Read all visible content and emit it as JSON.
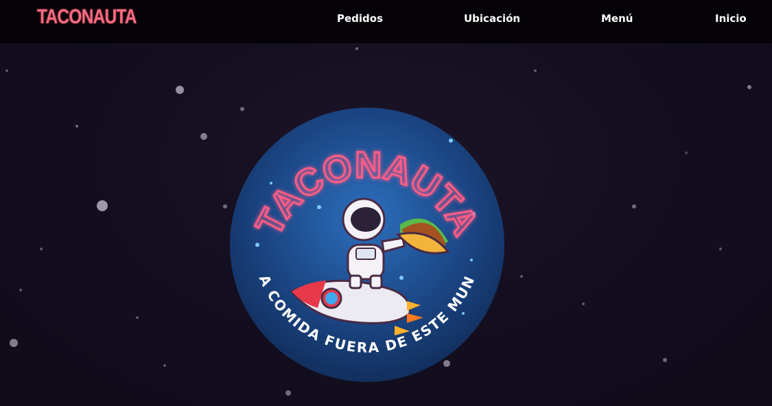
{
  "nav": {
    "brand": "TACONAUTA",
    "links": [
      "Pedidos",
      "Ubicación",
      "Menú",
      "Inicio"
    ]
  },
  "hero": {
    "logo_title": "TACONAUTA",
    "logo_slogan": "UNA COMIDA FUERA DE ESTE MUNDO"
  },
  "colors": {
    "neon_pink": "#ff5d86",
    "badge_blue": "#1e4f8f",
    "background": "#140f20"
  }
}
